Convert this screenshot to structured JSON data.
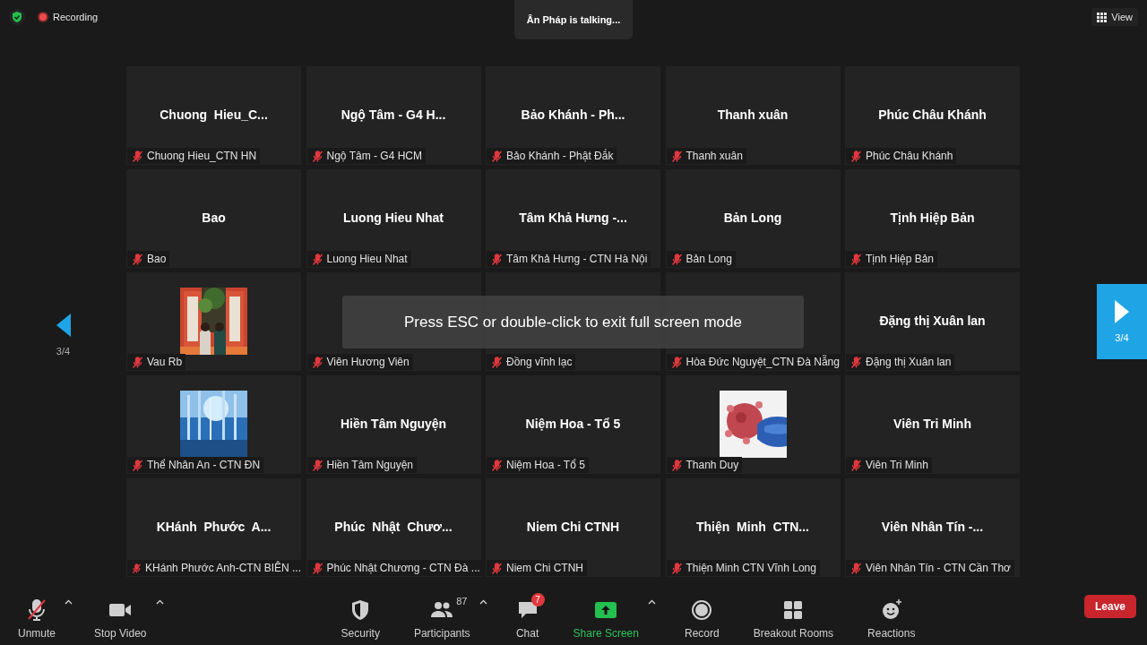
{
  "top_bar": {
    "recording": "Recording",
    "talking": "Ân Pháp is talking...",
    "view_button": "View"
  },
  "pager": {
    "previous_label": "3/4",
    "next_label": "3/4"
  },
  "tiles": [
    {
      "kind": "name",
      "display_name": "Chuong  Hieu_C...",
      "label": "Chuong Hieu_CTN HN",
      "muted": true
    },
    {
      "kind": "name",
      "display_name": "Ngộ Tâm - G4 H...",
      "label": "Ngộ Tâm - G4 HCM",
      "muted": true
    },
    {
      "kind": "name",
      "display_name": "Bảo Khánh - Ph...",
      "label": "Bảo Khánh - Phật Đắk",
      "muted": true
    },
    {
      "kind": "name",
      "display_name": "Thanh xuân",
      "label": "Thanh xuân",
      "muted": true
    },
    {
      "kind": "name",
      "display_name": "Phúc Châu Khánh",
      "label": "Phúc Châu Khánh",
      "muted": true
    },
    {
      "kind": "name",
      "display_name": "Bao",
      "label": "Bao",
      "muted": true
    },
    {
      "kind": "name",
      "display_name": "Luong Hieu Nhat",
      "label": "Luong Hieu Nhat",
      "muted": true
    },
    {
      "kind": "name",
      "display_name": "Tâm Khả Hưng -...",
      "label": "Tâm Khả Hưng - CTN Hà Nội",
      "muted": true
    },
    {
      "kind": "name",
      "display_name": "Bản Long",
      "label": "Bản Long",
      "muted": true
    },
    {
      "kind": "name",
      "display_name": "Tịnh Hiệp Bản",
      "label": "Tịnh Hiệp Bản",
      "muted": true
    },
    {
      "kind": "picture",
      "label": "Vau Rb",
      "muted": true
    },
    {
      "kind": "covered",
      "label": "Viên Hương Viên",
      "muted": true
    },
    {
      "kind": "covered",
      "label": "Đồng vĩnh lạc",
      "muted": true
    },
    {
      "kind": "covered",
      "label": "Hòa Đức Nguyệt_CTN Đà Nẵng",
      "muted": true
    },
    {
      "kind": "name",
      "display_name": "Đặng thị Xuân lan",
      "label": "Đặng thị Xuân lan",
      "muted": true
    },
    {
      "kind": "picture",
      "label": "Thể Nhân An - CTN ĐN",
      "muted": true
    },
    {
      "kind": "name",
      "display_name": "Hiền Tâm Nguyện",
      "label": "Hiền Tâm Nguyện",
      "muted": true
    },
    {
      "kind": "name",
      "display_name": "Niệm Hoa - Tổ 5",
      "label": "Niệm Hoa - Tổ 5",
      "muted": true
    },
    {
      "kind": "picture",
      "label": "Thanh Duy",
      "muted": true
    },
    {
      "kind": "name",
      "display_name": "Viên Tri Minh",
      "label": "Viên Tri Minh",
      "muted": true
    },
    {
      "kind": "name",
      "display_name": "KHánh  Phước  A...",
      "label": "KHánh Phước Anh-CTN BIÊN ...",
      "muted": true
    },
    {
      "kind": "name",
      "display_name": "Phúc  Nhật  Chươ...",
      "label": "Phúc Nhật Chương - CTN Đà ...",
      "muted": true
    },
    {
      "kind": "name",
      "display_name": "Niem Chi CTNH",
      "label": "Niem Chi CTNH",
      "muted": true
    },
    {
      "kind": "name",
      "display_name": "Thiện  Minh  CTN...",
      "label": "Thiện Minh CTN Vĩnh Long",
      "muted": true
    },
    {
      "kind": "name",
      "display_name": "Viên Nhân Tín -...",
      "label": "Viên Nhân Tín - CTN Cần Thơ",
      "muted": true
    }
  ],
  "notice": "Press ESC or double-click to exit full screen mode",
  "toolbar": {
    "left": [
      {
        "kind": "mic",
        "label": "Unmute",
        "muted": true,
        "caret": true,
        "highlighted": false
      },
      {
        "kind": "video",
        "label": "Stop Video",
        "caret": true,
        "highlighted": false
      }
    ],
    "center": [
      {
        "kind": "security",
        "label": "Security",
        "caret": false,
        "highlighted": false
      },
      {
        "kind": "participants",
        "label": "Participants",
        "count": "87",
        "caret": true,
        "highlighted": false
      },
      {
        "kind": "chat",
        "label": "Chat",
        "badge": "7",
        "caret": false,
        "highlighted": false
      },
      {
        "kind": "share",
        "label": "Share Screen",
        "caret": true,
        "highlighted": true
      },
      {
        "kind": "record",
        "label": "Record",
        "caret": false,
        "highlighted": false
      },
      {
        "kind": "breakout",
        "label": "Breakout Rooms",
        "caret": false,
        "highlighted": false
      },
      {
        "kind": "reactions",
        "label": "Reactions",
        "caret": false,
        "highlighted": false
      }
    ],
    "leave_button": "Leave"
  }
}
